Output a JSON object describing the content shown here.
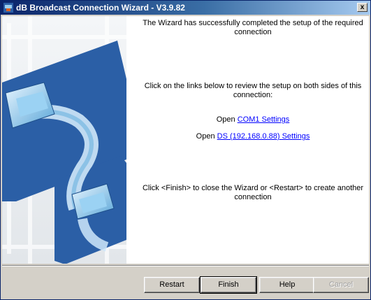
{
  "window": {
    "title": "dB Broadcast Connection Wizard - V3.9.82",
    "close_label": "x"
  },
  "messages": {
    "success": "The Wizard has successfully completed the setup of the required connection",
    "review": "Click on the links below to review the setup on both sides of this connection:",
    "link1_prefix": "Open",
    "link1_text": "COM1 Settings",
    "link2_prefix": "Open",
    "link2_text": "DS (192.168.0.88) Settings",
    "finish_hint": "Click <Finish> to close the Wizard or <Restart> to create another connection"
  },
  "buttons": {
    "restart": "Restart",
    "finish": "Finish",
    "help": "Help",
    "cancel": "Cancel"
  },
  "colors": {
    "title_gradient_start": "#0a246a",
    "link": "#0000ff",
    "art_blue": "#2b5fa6"
  }
}
